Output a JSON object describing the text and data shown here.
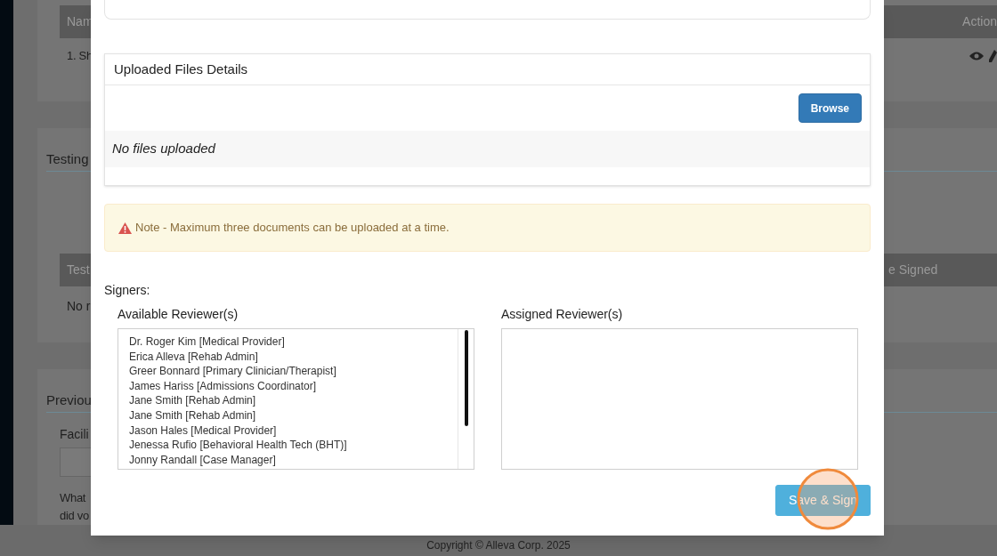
{
  "background": {
    "files_table": {
      "column_1": "Nam",
      "column_last": "Action",
      "row_text": "1. Sh"
    },
    "testing": {
      "title": "Testing",
      "column_1": "Test",
      "column_last": "e Signed",
      "empty_text": "No r"
    },
    "previous": {
      "title": "Previou",
      "field_label": "Facili",
      "question_line_1": "What",
      "question_line_2": "did vo"
    },
    "footer": "Copyright © Alleva Corp. 2025"
  },
  "modal": {
    "files_panel": {
      "title": "Uploaded Files Details",
      "browse_button": "Browse",
      "empty_text": "No files uploaded"
    },
    "alert": "Note - Maximum three documents can be uploaded at a time.",
    "signers_label": "Signers:",
    "available": {
      "label": "Available Reviewer(s)",
      "items": [
        "Dr. Roger Kim [Medical Provider]",
        "Erica Alleva [Rehab Admin]",
        "Greer Bonnard [Primary Clinician/Therapist]",
        "James Hariss [Admissions Coordinator]",
        "Jane Smith [Rehab Admin]",
        "Jane Smith [Rehab Admin]",
        "Jason Hales [Medical Provider]",
        "Jenessa Rufio [Behavioral Health Tech (BHT)]",
        "Jonny Randall [Case Manager]"
      ]
    },
    "assigned": {
      "label": "Assigned Reviewer(s)"
    },
    "save_button": {
      "label": "Save & Sign",
      "disabled": true
    }
  }
}
